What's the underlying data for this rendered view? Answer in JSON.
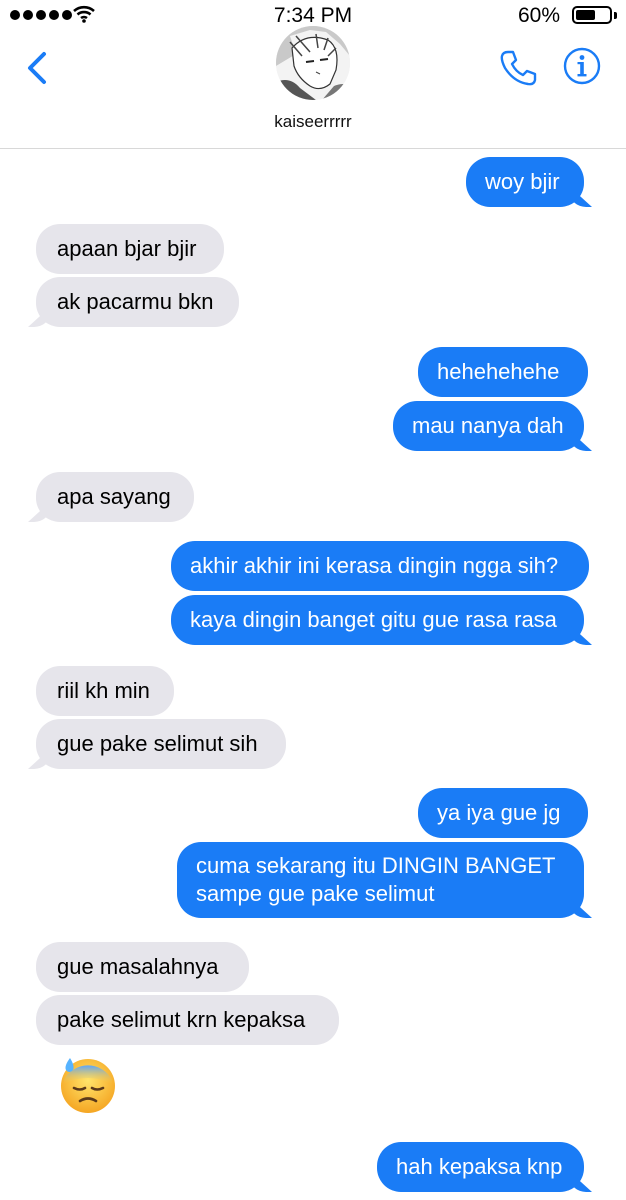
{
  "status_bar": {
    "time": "7:34 PM",
    "battery_percent": "60%",
    "battery_level": 0.6,
    "signal_bars": 5,
    "icons": [
      "signal-dots-icon",
      "wifi-icon",
      "battery-icon"
    ]
  },
  "header": {
    "contact_name": "kaiseerrrrr",
    "icons": [
      "back-chevron-icon",
      "avatar",
      "phone-icon",
      "info-icon"
    ]
  },
  "colors": {
    "accent": "#1a7cf6",
    "incoming_bubble": "#e6e5eb",
    "outgoing_text": "#ffffff"
  },
  "messages": [
    {
      "from": "me",
      "text": "woy bjir"
    },
    {
      "from": "them",
      "text": "apaan bjar bjir"
    },
    {
      "from": "them",
      "text": "ak pacarmu bkn"
    },
    {
      "from": "me",
      "text": "hehehehehe"
    },
    {
      "from": "me",
      "text": "mau nanya dah"
    },
    {
      "from": "them",
      "text": "apa sayang"
    },
    {
      "from": "me",
      "text": "akhir akhir ini kerasa dingin ngga sih?"
    },
    {
      "from": "me",
      "text": "kaya dingin banget gitu gue rasa rasa"
    },
    {
      "from": "them",
      "text": "riil kh min"
    },
    {
      "from": "them",
      "text": "gue pake selimut sih"
    },
    {
      "from": "me",
      "text": "ya iya gue jg"
    },
    {
      "from": "me",
      "text": "cuma sekarang itu DINGIN BANGET sampe gue pake selimut"
    },
    {
      "from": "them",
      "text": "gue masalahnya"
    },
    {
      "from": "them",
      "text": "pake selimut krn kepaksa"
    },
    {
      "from": "them",
      "emoji": "downcast-face-with-sweat-icon"
    },
    {
      "from": "me",
      "text": "hah kepaksa knp"
    }
  ]
}
